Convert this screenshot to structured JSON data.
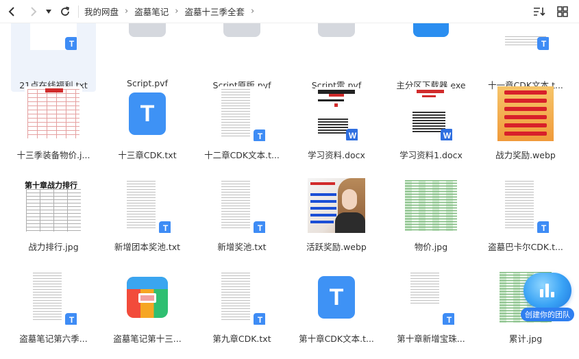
{
  "toolbar": {
    "back_label": "back",
    "forward_label": "forward",
    "breadcrumbs": [
      "我的网盘",
      "盗墓笔记",
      "盗墓十三季全套"
    ]
  },
  "files": [
    {
      "name": "21点在线福利.txt",
      "kind": "txt"
    },
    {
      "name": "Script.pvf",
      "kind": "pvf"
    },
    {
      "name": "Script原版.pvf",
      "kind": "pvf"
    },
    {
      "name": "Script雷.pvf",
      "kind": "pvf"
    },
    {
      "name": "主分区下载器.exe",
      "kind": "exe"
    },
    {
      "name": "十一章CDK文本.t...",
      "kind": "txt"
    },
    {
      "name": "十三季装备物价.j...",
      "kind": "jpg"
    },
    {
      "name": "十三章CDK.txt",
      "kind": "txt"
    },
    {
      "name": "十二章CDK文本.t...",
      "kind": "txt"
    },
    {
      "name": "学习资料.docx",
      "kind": "docx"
    },
    {
      "name": "学习资料1.docx",
      "kind": "docx"
    },
    {
      "name": "战力奖励.webp",
      "kind": "webp"
    },
    {
      "name": "战力排行.jpg",
      "kind": "jpg",
      "thumb_text": "第十章战力排行"
    },
    {
      "name": "新增团本奖池.txt",
      "kind": "txt"
    },
    {
      "name": "新增奖池.txt",
      "kind": "txt"
    },
    {
      "name": "活跃奖励.webp",
      "kind": "webp"
    },
    {
      "name": "物价.jpg",
      "kind": "jpg"
    },
    {
      "name": "盗墓巴卡尔CDK.t...",
      "kind": "txt"
    },
    {
      "name": "盗墓笔记第六季...",
      "kind": "txt"
    },
    {
      "name": "盗墓笔记第十三...",
      "kind": "zip"
    },
    {
      "name": "第九章CDK.txt",
      "kind": "txt"
    },
    {
      "name": "第十章CDK文本.t...",
      "kind": "txt"
    },
    {
      "name": "第十章新增宝珠...",
      "kind": "txt"
    },
    {
      "name": "累计.jpg",
      "kind": "jpg"
    }
  ],
  "widget": {
    "label": "创建你的团队"
  },
  "colors": {
    "accent": "#3e8cf5",
    "selected_bg": "#eef3fb"
  }
}
